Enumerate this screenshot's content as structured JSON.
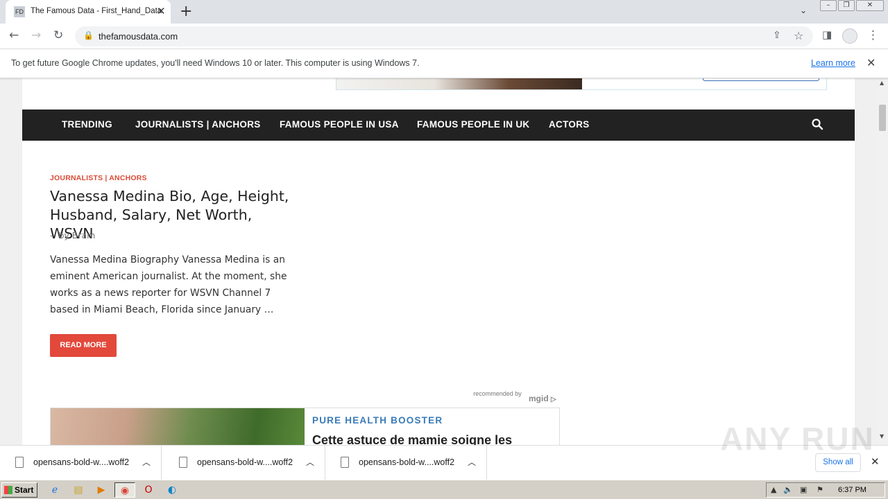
{
  "browser": {
    "tab": {
      "favicon_text": "FD",
      "title": "The Famous Data - First_Hand_Data"
    },
    "url": "thefamousdata.com",
    "infobar": {
      "message": "To get future Google Chrome updates, you'll need Windows 10 or later. This computer is using Windows 7.",
      "link": "Learn more"
    }
  },
  "site": {
    "nav": {
      "items": [
        "TRENDING",
        "JOURNALISTS | ANCHORS",
        "FAMOUS PEOPLE IN USA",
        "FAMOUS PEOPLE IN UK",
        "ACTORS"
      ]
    },
    "article": {
      "category": "JOURNALISTS | ANCHORS",
      "title": "Vanessa Medina Bio, Age, Height, Husband, Salary, Net Worth, WSVN",
      "byline_sep": "-",
      "byline": "by Bram",
      "excerpt": "Vanessa Medina Biography Vanessa Medina is an eminent American journalist. At the moment, she works as a news reporter for WSVN Channel 7 based in Miami Beach, Florida since January …",
      "read_more": "READ MORE"
    },
    "ad": {
      "recommended_by": "recommended by",
      "network": "mgid",
      "brand": "PURE HEALTH BOOSTER",
      "title": "Cette astuce de mamie soigne les"
    }
  },
  "downloads": {
    "items": [
      {
        "name": "opensans-bold-w....woff2"
      },
      {
        "name": "opensans-bold-w....woff2"
      },
      {
        "name": "opensans-bold-w....woff2"
      }
    ],
    "show_all": "Show all"
  },
  "taskbar": {
    "start": "Start",
    "clock": "6:37 PM"
  },
  "watermark": "ANY RUN",
  "colors": {
    "nav_bg": "#222222",
    "accent_red": "#e2493b",
    "ad_brand_blue": "#3a7bb8",
    "link_blue": "#1a73e8"
  }
}
